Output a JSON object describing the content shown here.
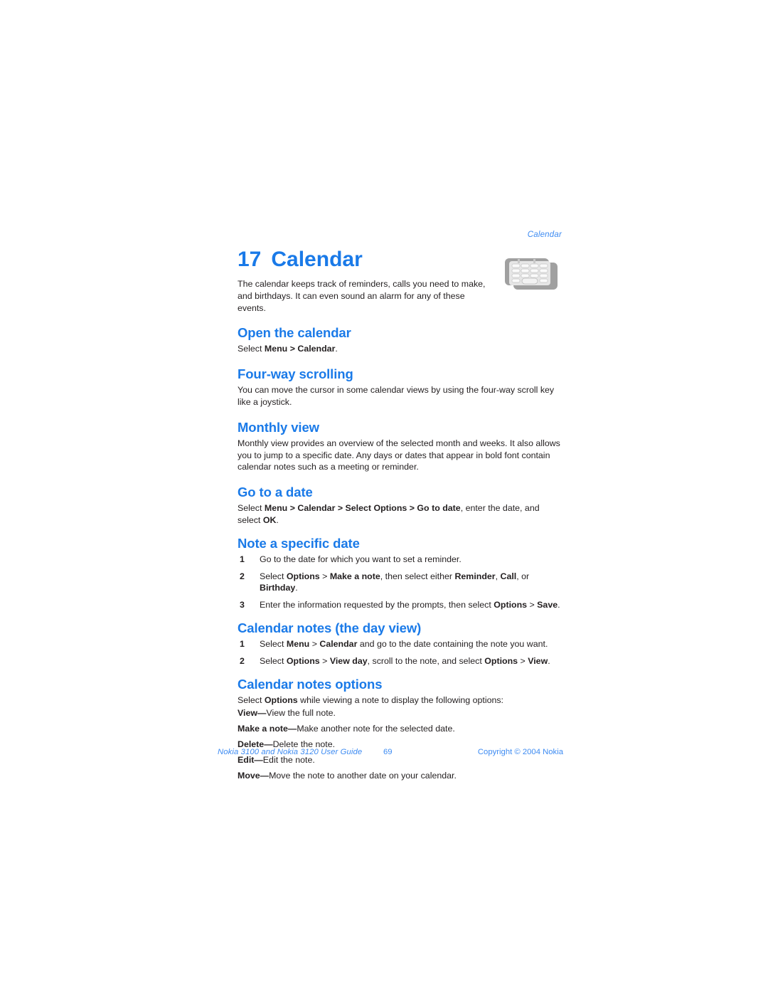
{
  "running_header": "Calendar",
  "chapter": {
    "number": "17",
    "title": "Calendar",
    "icon_name": "calendar-keypad-icon"
  },
  "intro": "The calendar keeps track of reminders, calls you need to make, and birthdays. It can even sound an alarm for any of these events.",
  "sections": {
    "open_the_calendar": {
      "heading": "Open the calendar",
      "line_plain_1": "Select ",
      "line_bold_1": "Menu",
      "line_plain_2": " > ",
      "line_bold_2": "Calendar",
      "line_plain_3": "."
    },
    "four_way_scrolling": {
      "heading": "Four-way scrolling",
      "body": "You can move the cursor in some calendar views by using the four-way scroll key like a joystick."
    },
    "monthly_view": {
      "heading": "Monthly view",
      "body": "Monthly view provides an overview of the selected month and weeks. It also allows you to jump to a specific date. Any days or dates that appear in bold font contain calendar notes such as a meeting or reminder."
    },
    "go_to_a_date": {
      "heading": "Go to a date",
      "plain_1": "Select ",
      "bold_1": "Menu",
      "plain_2": " > ",
      "bold_2": "Calendar",
      "plain_3": " > ",
      "bold_3": "Select Options",
      "plain_4": " > ",
      "bold_4": "Go to date",
      "plain_5": ", enter the date, and select ",
      "bold_5": "OK",
      "plain_6": "."
    },
    "note_a_specific_date": {
      "heading": "Note a specific date",
      "steps": [
        {
          "num": "1",
          "parts": [
            {
              "text": "Go to the date for which you want to set a reminder.",
              "bold": false
            }
          ]
        },
        {
          "num": "2",
          "parts": [
            {
              "text": "Select ",
              "bold": false
            },
            {
              "text": "Options",
              "bold": true
            },
            {
              "text": " > ",
              "bold": false
            },
            {
              "text": "Make a note",
              "bold": true
            },
            {
              "text": ", then select either ",
              "bold": false
            },
            {
              "text": "Reminder",
              "bold": true
            },
            {
              "text": ", ",
              "bold": false
            },
            {
              "text": "Call",
              "bold": true
            },
            {
              "text": ", or ",
              "bold": false
            },
            {
              "text": "Birthday",
              "bold": true
            },
            {
              "text": ".",
              "bold": false
            }
          ]
        },
        {
          "num": "3",
          "parts": [
            {
              "text": "Enter the information requested by the prompts, then select ",
              "bold": false
            },
            {
              "text": "Options",
              "bold": true
            },
            {
              "text": " > ",
              "bold": false
            },
            {
              "text": "Save",
              "bold": true
            },
            {
              "text": ".",
              "bold": false
            }
          ]
        }
      ]
    },
    "calendar_notes_day_view": {
      "heading": "Calendar notes (the day view)",
      "steps": [
        {
          "num": "1",
          "parts": [
            {
              "text": "Select ",
              "bold": false
            },
            {
              "text": "Menu",
              "bold": true
            },
            {
              "text": " > ",
              "bold": false
            },
            {
              "text": "Calendar",
              "bold": true
            },
            {
              "text": " and go to the date containing the note you want.",
              "bold": false
            }
          ]
        },
        {
          "num": "2",
          "parts": [
            {
              "text": "Select ",
              "bold": false
            },
            {
              "text": "Options",
              "bold": true
            },
            {
              "text": " > ",
              "bold": false
            },
            {
              "text": "View day",
              "bold": true
            },
            {
              "text": ", scroll to the note, and select ",
              "bold": false
            },
            {
              "text": "Options",
              "bold": true
            },
            {
              "text": " > ",
              "bold": false
            },
            {
              "text": "View",
              "bold": true
            },
            {
              "text": ".",
              "bold": false
            }
          ]
        }
      ]
    },
    "calendar_notes_options": {
      "heading": "Calendar notes options",
      "lead_plain_1": "Select ",
      "lead_bold_1": "Options",
      "lead_plain_2": " while viewing a note to display the following options:",
      "options": [
        {
          "term": "View",
          "dash": "—",
          "desc": "View the full note."
        },
        {
          "term": "Make a note",
          "dash": "—",
          "desc": "Make another note for the selected date."
        },
        {
          "term": "Delete",
          "dash": "—",
          "desc": "Delete the note."
        },
        {
          "term": "Edit",
          "dash": "—",
          "desc": "Edit the note."
        },
        {
          "term": "Move",
          "dash": "—",
          "desc": "Move the note to another date on your calendar."
        }
      ]
    }
  },
  "footer": {
    "left": "Nokia 3100 and Nokia 3120 User Guide",
    "page_number": "69",
    "right": "Copyright © 2004 Nokia"
  },
  "colors": {
    "heading_blue": "#1a7ae8",
    "footer_blue": "#3d8bf2",
    "body_text": "#231f20",
    "icon_gray_dark": "#9a9a9a",
    "icon_gray_light": "#e3e3e3"
  }
}
